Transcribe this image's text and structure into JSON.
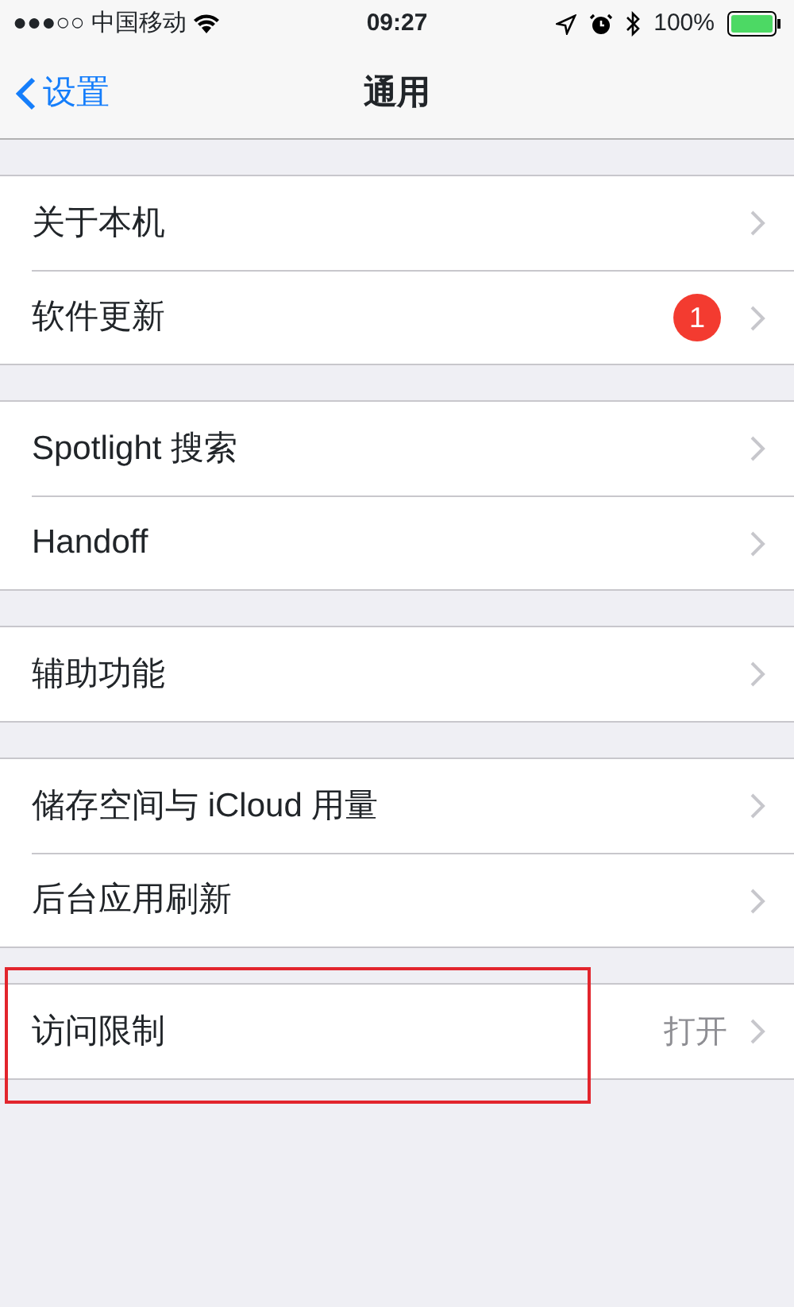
{
  "status_bar": {
    "signal": "●●●○○",
    "carrier": "中国移动",
    "time": "09:27",
    "battery": "100%"
  },
  "nav": {
    "back": "设置",
    "title": "通用"
  },
  "groups": [
    {
      "rows": [
        {
          "label": "关于本机",
          "highlighted": false
        },
        {
          "label": "软件更新",
          "badge": "1",
          "highlighted": false
        }
      ]
    },
    {
      "rows": [
        {
          "label": "Spotlight 搜索",
          "highlighted": false
        },
        {
          "label": "Handoff",
          "highlighted": false
        }
      ]
    },
    {
      "rows": [
        {
          "label": "辅助功能",
          "highlighted": false
        }
      ]
    },
    {
      "rows": [
        {
          "label": "储存空间与 iCloud 用量",
          "highlighted": false
        },
        {
          "label": "后台应用刷新",
          "highlighted": false
        }
      ]
    },
    {
      "rows": [
        {
          "label": "访问限制",
          "value": "打开",
          "highlighted": true
        }
      ]
    }
  ]
}
